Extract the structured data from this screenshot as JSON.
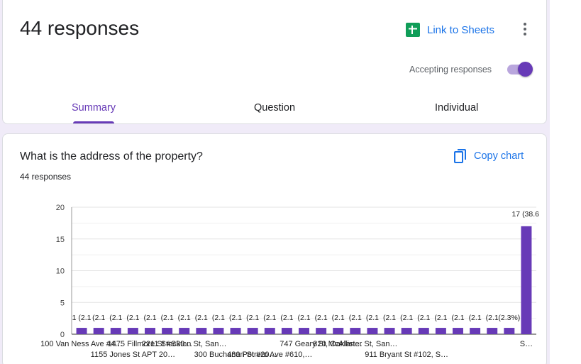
{
  "header": {
    "title": "44 responses",
    "link_sheets": "Link to Sheets",
    "accepting": "Accepting responses",
    "accepting_on": true,
    "tabs": [
      {
        "label": "Summary",
        "active": true
      },
      {
        "label": "Question",
        "active": false
      },
      {
        "label": "Individual",
        "active": false
      }
    ]
  },
  "question": {
    "title": "What is the address of the property?",
    "count": "44 responses",
    "copy_chart": "Copy chart"
  },
  "colors": {
    "accent": "#673ab7",
    "link": "#1a73e8",
    "sheets_green": "#0f9d58"
  },
  "chart_data": {
    "type": "bar",
    "color": "#673ab7",
    "ylim": [
      0,
      20
    ],
    "yticks": [
      0,
      5,
      10,
      15,
      20
    ],
    "grid": true,
    "legend": "none",
    "categories": [
      "100 Van Ness Ave #4…",
      "",
      "",
      "1155 Jones St APT 20…",
      "1475 Fillmore St #S30…",
      "",
      "2211 Stockton St, San…",
      "",
      "",
      "300 Buchanan St #20…",
      "",
      "480 Potrero Ave #610,…",
      "",
      "",
      "747 Geary St, Oaklan…",
      "",
      "820 McAllister St, San…",
      "",
      "",
      "911 Bryant St #102, S…",
      "",
      "",
      "",
      "",
      "",
      "",
      "S…"
    ],
    "values": [
      1,
      1,
      1,
      1,
      1,
      1,
      1,
      1,
      1,
      1,
      1,
      1,
      1,
      1,
      1,
      1,
      1,
      1,
      1,
      1,
      1,
      1,
      1,
      1,
      1,
      1,
      17
    ],
    "data_labels": [
      "1 (2.1",
      "(2.1",
      "(2.1",
      "(2.1",
      "(2.1",
      "(2.1",
      "(2.1",
      "(2.1",
      "(2.1",
      "(2.1",
      "(2.1",
      "(2.1",
      "(2.1",
      "(2.1",
      "(2.1",
      "(2.1",
      "(2.1",
      "(2.1",
      "(2.1",
      "(2.1",
      "(2.1",
      "(2.1",
      "(2.1",
      "(2.1",
      "(2.1",
      "(2.3%)",
      "17 (38.6"
    ]
  }
}
